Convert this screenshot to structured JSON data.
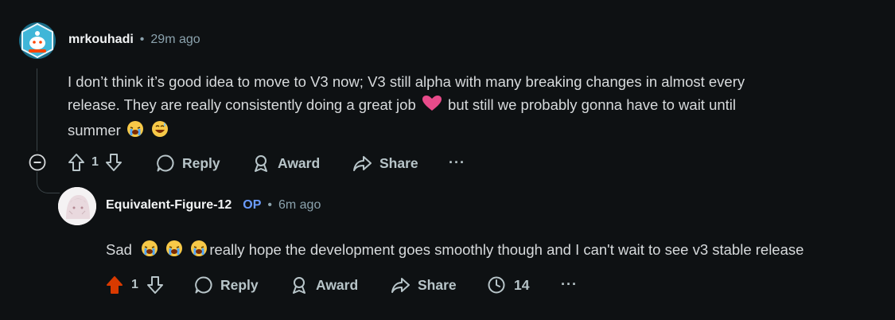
{
  "comment1": {
    "username": "mrkouhadi",
    "separator": "•",
    "timestamp": "29m ago",
    "text_line1": "I don’t think it’s good idea to move to V3 now; V3 still alpha with many breaking changes in almost every",
    "text_line2a": "release. They are really consistently doing a great job",
    "text_line2b": "but still we probably gonna have to wait until",
    "text_line3": "summer",
    "score": "1",
    "reply_label": "Reply",
    "award_label": "Award",
    "share_label": "Share",
    "more_label": "···"
  },
  "comment2": {
    "username": "Equivalent-Figure-12",
    "op_badge": "OP",
    "separator": "•",
    "timestamp": "6m ago",
    "text_before": "Sad",
    "text_after": "really hope the development goes smoothly though and I can't wait to see v3 stable release",
    "score": "1",
    "reply_label": "Reply",
    "award_label": "Award",
    "share_label": "Share",
    "views_count": "14",
    "more_label": "···"
  },
  "colors": {
    "background": "#0e1113",
    "upvote_active": "#d93a00",
    "op_badge": "#6b9cff",
    "heart": "#e84b8a"
  },
  "icons": [
    "collapse-thread-icon",
    "upvote-icon",
    "downvote-icon",
    "comment-bubble-icon",
    "award-icon",
    "share-icon",
    "views-icon",
    "more-icon",
    "crying-emoji",
    "sweat-smile-emoji",
    "heart-emoji"
  ]
}
